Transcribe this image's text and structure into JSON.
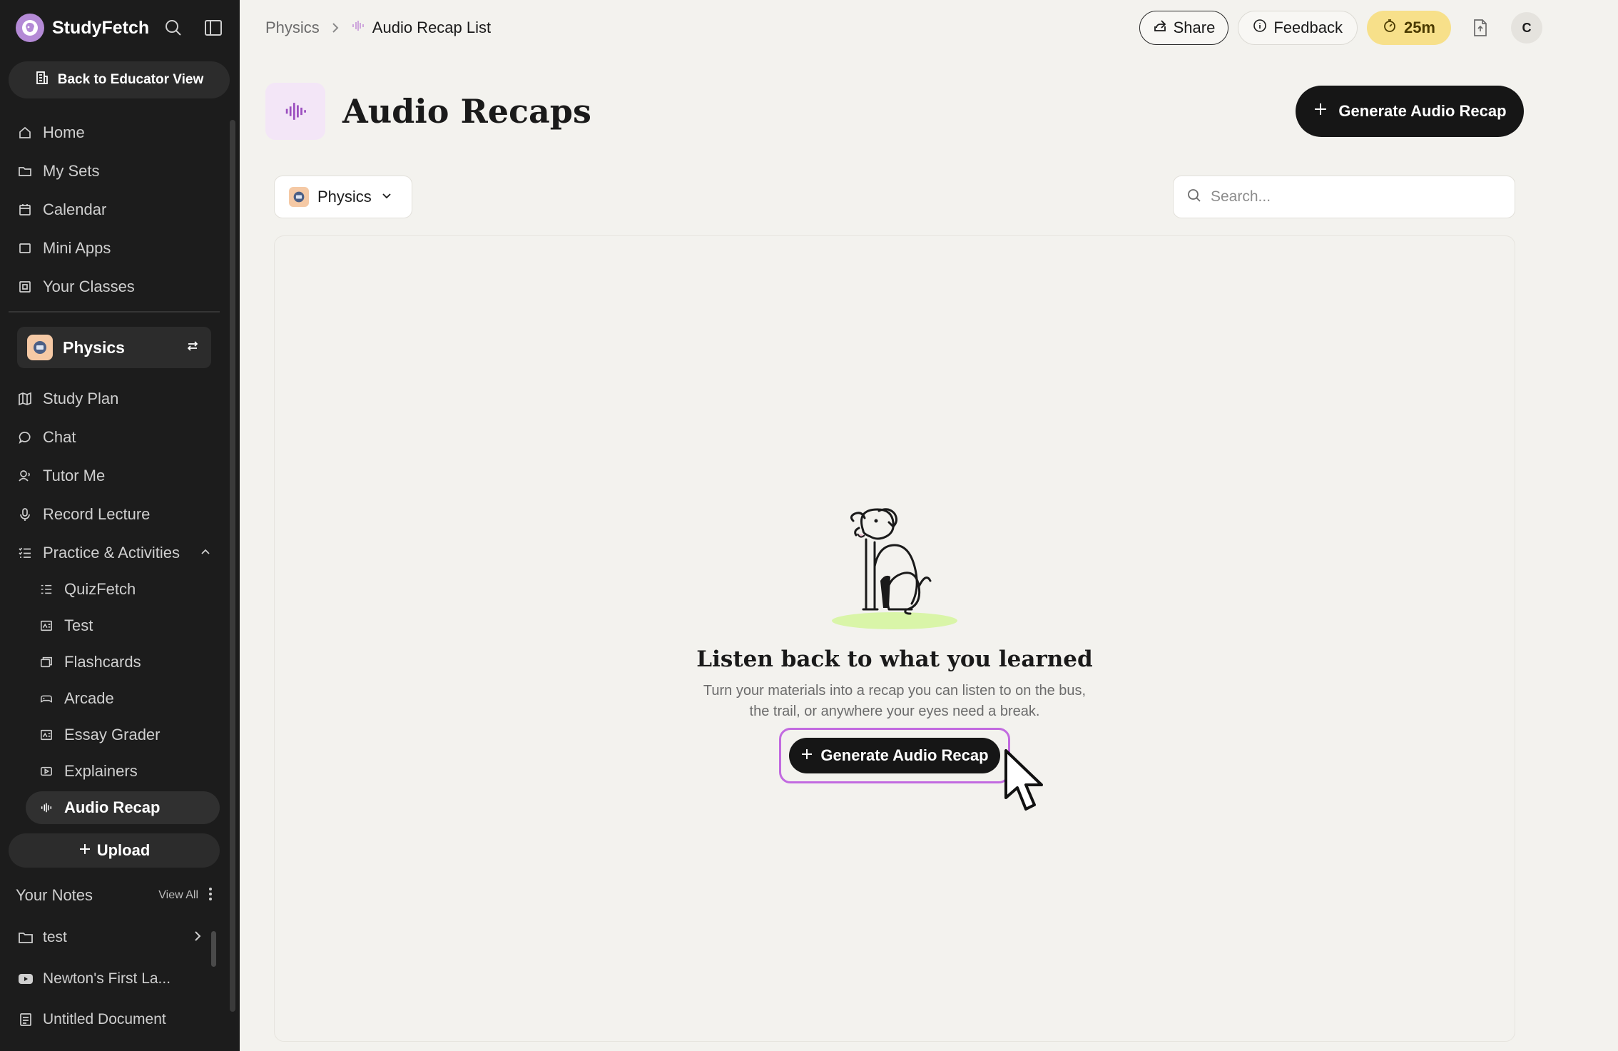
{
  "brand": {
    "name": "StudyFetch"
  },
  "sidebar": {
    "educator_button": "Back to Educator View",
    "nav": [
      {
        "label": "Home",
        "icon": "home-icon"
      },
      {
        "label": "My Sets",
        "icon": "folder-icon"
      },
      {
        "label": "Calendar",
        "icon": "calendar-icon"
      },
      {
        "label": "Mini Apps",
        "icon": "app-icon"
      },
      {
        "label": "Your Classes",
        "icon": "classes-icon"
      }
    ],
    "current_class": "Physics",
    "class_nav": [
      {
        "label": "Study Plan",
        "icon": "map-icon"
      },
      {
        "label": "Chat",
        "icon": "chat-icon"
      },
      {
        "label": "Tutor Me",
        "icon": "tutor-icon"
      },
      {
        "label": "Record Lecture",
        "icon": "mic-icon"
      },
      {
        "label": "Practice & Activities",
        "icon": "list-icon"
      }
    ],
    "activities": [
      {
        "label": "QuizFetch",
        "icon": "list-icon"
      },
      {
        "label": "Test",
        "icon": "test-icon"
      },
      {
        "label": "Flashcards",
        "icon": "cards-icon"
      },
      {
        "label": "Arcade",
        "icon": "gamepad-icon"
      },
      {
        "label": "Essay Grader",
        "icon": "essay-icon"
      },
      {
        "label": "Explainers",
        "icon": "video-icon"
      },
      {
        "label": "Audio Recap",
        "icon": "audio-wave-icon"
      }
    ],
    "upload_label": "Upload",
    "notes_title": "Your Notes",
    "view_all": "View All",
    "notes": [
      {
        "label": "test",
        "icon": "folder-icon"
      },
      {
        "label": "Newton's First La...",
        "icon": "youtube-icon"
      },
      {
        "label": "Untitled Document",
        "icon": "document-icon"
      }
    ]
  },
  "breadcrumb": {
    "root": "Physics",
    "current": "Audio Recap List"
  },
  "top_actions": {
    "share": "Share",
    "feedback": "Feedback",
    "timer": "25m",
    "avatar": "C"
  },
  "header": {
    "title": "Audio Recaps",
    "generate_button": "Generate Audio Recap"
  },
  "filters": {
    "class_select": "Physics",
    "search_placeholder": "Search..."
  },
  "empty_state": {
    "title": "Listen back to what you learned",
    "description_line1": "Turn your materials into a recap you can listen to on the bus,",
    "description_line2": "the trail, or anywhere your eyes need a break.",
    "button": "Generate Audio Recap"
  },
  "colors": {
    "sidebar_bg": "#1c1c1c",
    "page_bg": "#f3f2ee",
    "accent_purple": "#c26ae0",
    "timer_yellow": "#f7e08a",
    "button_dark": "#161616"
  }
}
